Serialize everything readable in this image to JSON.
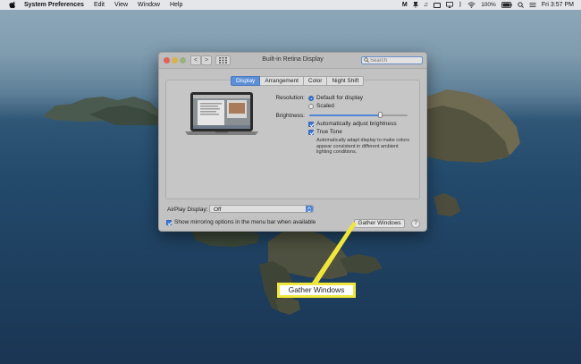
{
  "menubar": {
    "app_name": "System Preferences",
    "menus": [
      "Edit",
      "View",
      "Window",
      "Help"
    ],
    "battery": "100%",
    "clock": "Fri 3:57 PM",
    "status_icons": [
      "gmail-icon",
      "pushpin-icon",
      "music-note-icon",
      "screen-icon",
      "airplay-icon",
      "bluetooth-icon",
      "wifi-icon",
      "battery-icon",
      "search-icon",
      "control-center-icon"
    ]
  },
  "window": {
    "title": "Built-in Retina Display",
    "search_placeholder": "Search",
    "tabs": [
      {
        "label": "Display",
        "active": true
      },
      {
        "label": "Arrangement",
        "active": false
      },
      {
        "label": "Color",
        "active": false
      },
      {
        "label": "Night Shift",
        "active": false
      }
    ],
    "resolution": {
      "label": "Resolution:",
      "options": [
        {
          "label": "Default for display",
          "selected": true
        },
        {
          "label": "Scaled",
          "selected": false
        }
      ]
    },
    "brightness": {
      "label": "Brightness:",
      "level_fraction": 0.72
    },
    "auto_brightness": {
      "label": "Automatically adjust brightness",
      "checked": true
    },
    "true_tone": {
      "label": "True Tone",
      "checked": true,
      "description": "Automatically adapt display to make colors appear consistent in different ambient lighting conditions."
    },
    "airplay": {
      "label": "AirPlay Display:",
      "value": "Off"
    },
    "mirroring": {
      "label": "Show mirroring options in the menu bar when available",
      "checked": true
    },
    "gather_button": "Gather Windows",
    "help_button": "?",
    "nav_back": "<",
    "nav_forward": ">"
  },
  "callout": {
    "text": "Gather Windows",
    "color": "#f0e63b"
  },
  "colors": {
    "accent": "#5c8fd8",
    "window_bg": "#c2c2c2",
    "callout_border": "#f0e63b"
  }
}
